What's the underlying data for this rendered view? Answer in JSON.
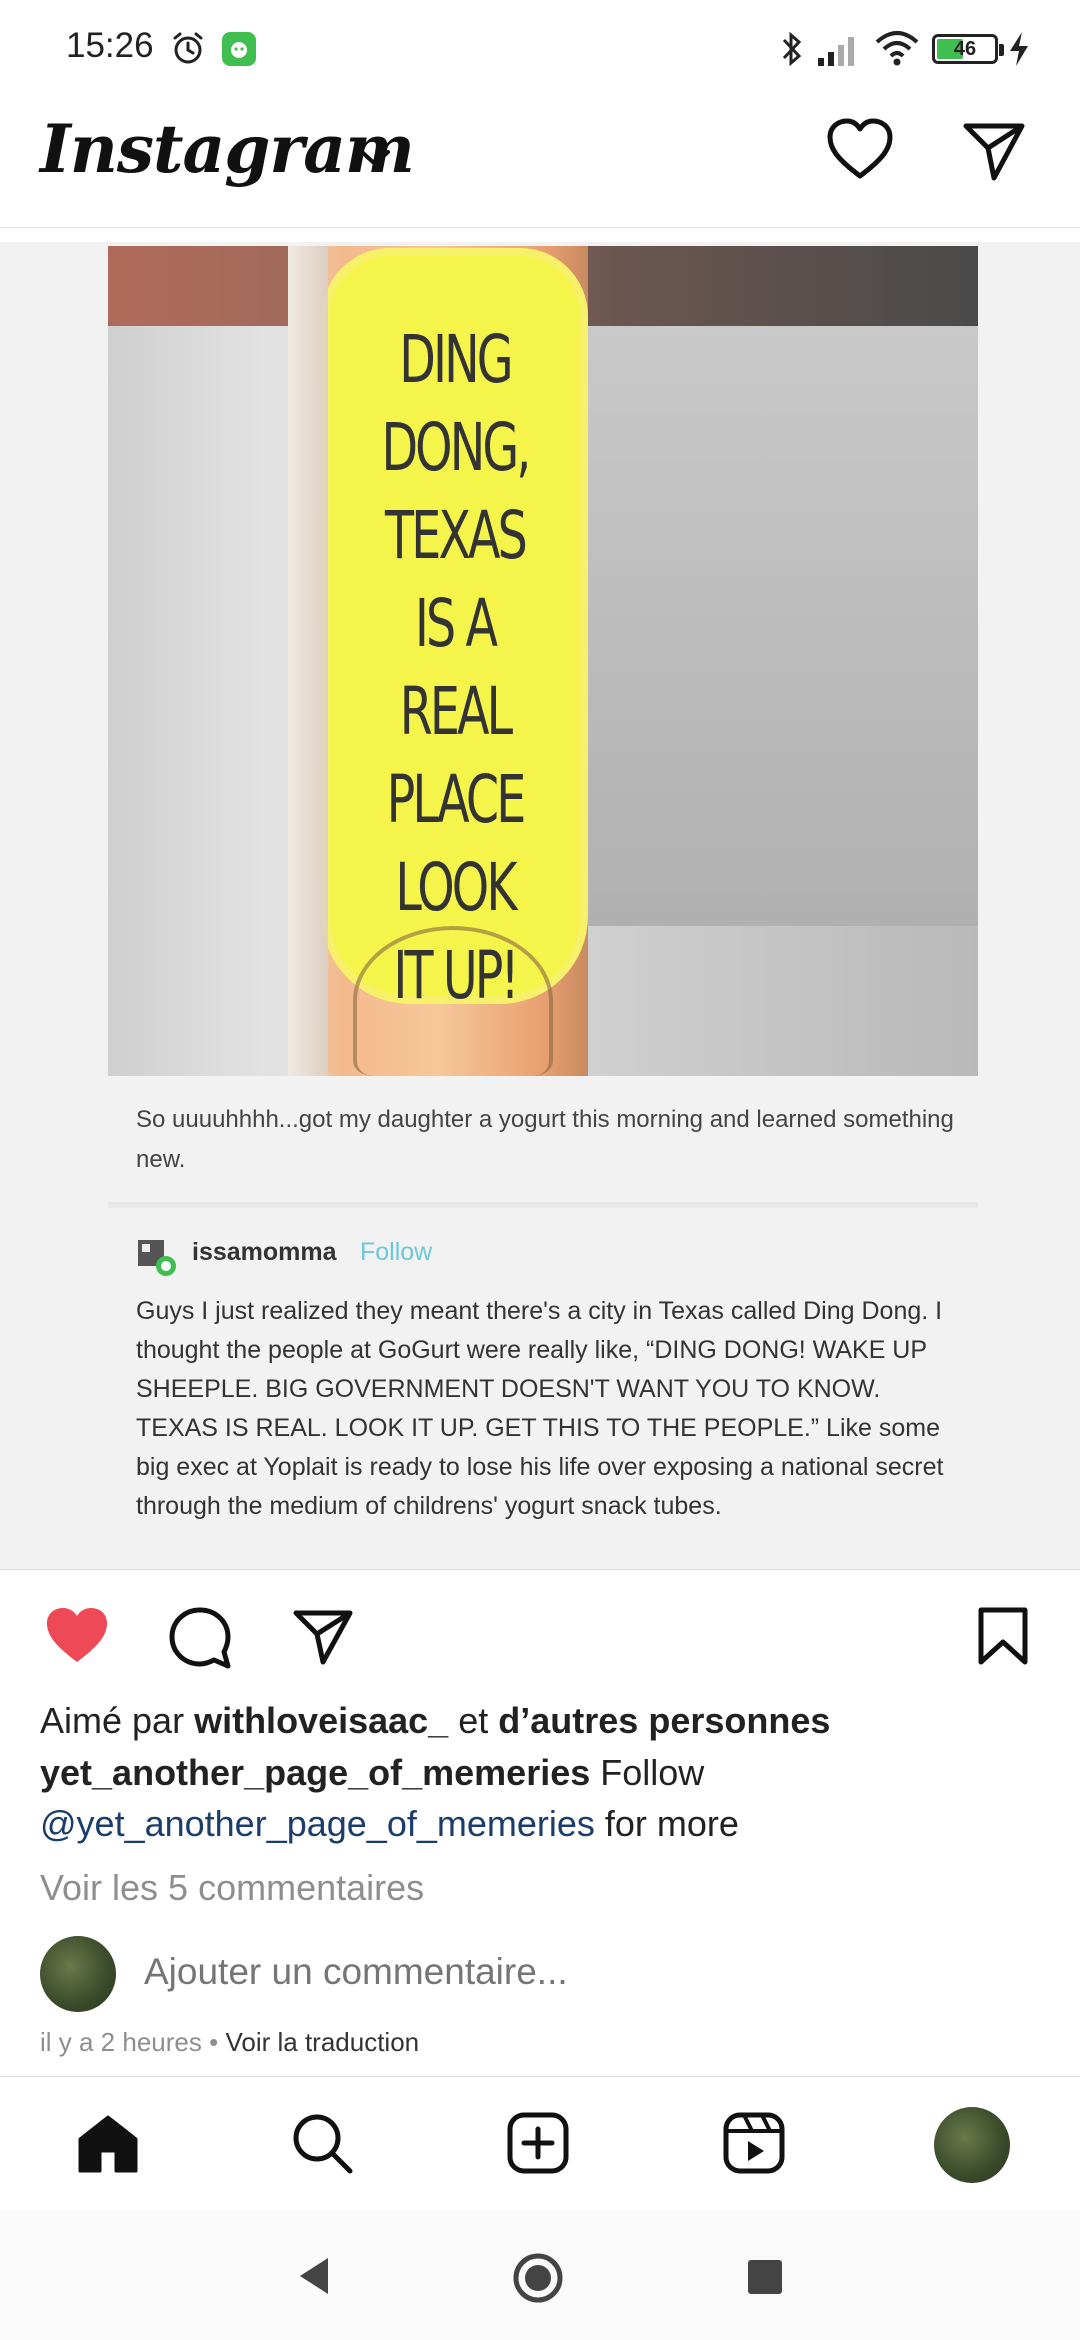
{
  "status_bar": {
    "time": "15:26",
    "battery": "46",
    "battery_color": "#3fbf4f"
  },
  "header": {
    "logo": "Instagram",
    "icons": [
      "chevron-down-icon",
      "heart-icon",
      "send-icon"
    ]
  },
  "post": {
    "image": {
      "tube_text": "DING DONG,\nTEXAS\nIS A\nREAL PLACE\nLOOK\nIT UP!",
      "caption": "So uuuuhhhh...got my daughter a yogurt this morning and learned something new.",
      "reply_user": "issamomma",
      "reply_follow": "Follow",
      "reply_body": "Guys I just realized they meant there's a city in Texas called Ding Dong. I thought the people at GoGurt were really like, “DING DONG! WAKE UP SHEEPLE. BIG GOVERNMENT DOESN'T WANT YOU TO KNOW. TEXAS IS REAL. LOOK IT UP. GET THIS TO THE PEOPLE.” Like some big exec at Yoplait is ready to lose his life over exposing a national secret through the medium of childrens' yogurt snack tubes."
    },
    "actions": {
      "like_color": "#ed4956",
      "icons": [
        "heart-filled-icon",
        "comment-icon",
        "send-icon",
        "bookmark-icon"
      ]
    },
    "likes": {
      "prefix": "Aimé par",
      "user": "withloveisaac_",
      "middle": "et",
      "others": "d’autres personnes"
    },
    "caption": {
      "username": "yet_another_page_of_memeries",
      "text1": "Follow",
      "mention": "@yet_another_page_of_memeries",
      "text2": "for more"
    },
    "view_comments": "Voir les 5 commentaires",
    "comment_placeholder": "Ajouter un commentaire...",
    "timestamp": "il y a 2 heures",
    "separator": "•",
    "translate": "Voir la traduction"
  },
  "bottom_nav": {
    "items": [
      "home-icon",
      "search-icon",
      "add-icon",
      "reels-icon",
      "profile-avatar"
    ]
  },
  "android_nav": {
    "items": [
      "back-icon",
      "home-icon",
      "recents-icon"
    ]
  }
}
